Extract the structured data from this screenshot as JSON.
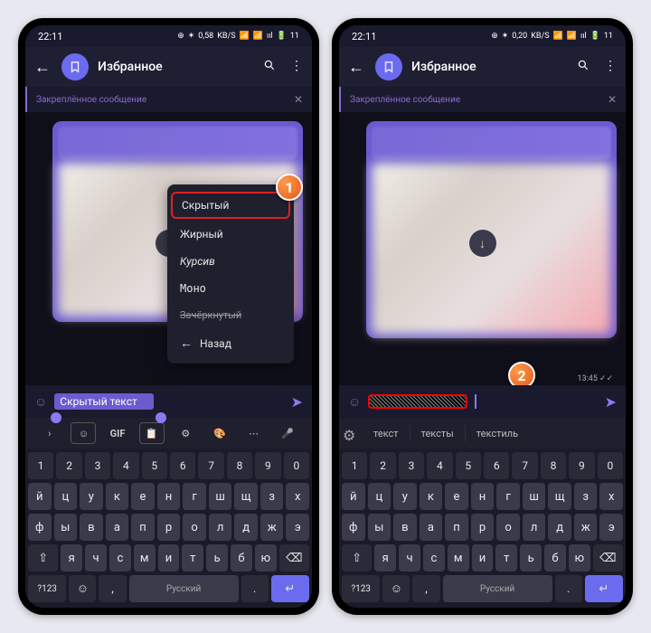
{
  "status": {
    "time": "22:11",
    "net1": "0,58",
    "net2": "0,20",
    "unit": "KB/S",
    "battery": "11"
  },
  "header": {
    "title": "Избранное"
  },
  "pinned": {
    "label": "Закреплённое сообщение"
  },
  "context_menu": {
    "items": [
      "Скрытый",
      "Жирный",
      "Курсив",
      "Моно"
    ],
    "strike": "Зачёркнутый",
    "back": "Назад"
  },
  "callouts": {
    "one": "1",
    "two": "2"
  },
  "input": {
    "left_text": "Скрытый текст"
  },
  "chat": {
    "time": "13:45"
  },
  "kb_tools": {
    "gif": "GIF"
  },
  "suggestions": [
    "текст",
    "тексты",
    "текстиль"
  ],
  "kb": {
    "row_num": [
      "1",
      "2",
      "3",
      "4",
      "5",
      "6",
      "7",
      "8",
      "9",
      "0"
    ],
    "row1": [
      "й",
      "ц",
      "у",
      "к",
      "е",
      "н",
      "г",
      "ш",
      "щ",
      "з",
      "х"
    ],
    "row2": [
      "ф",
      "ы",
      "в",
      "а",
      "п",
      "р",
      "о",
      "л",
      "д",
      "ж",
      "э"
    ],
    "row3": [
      "я",
      "ч",
      "с",
      "м",
      "и",
      "т",
      "ь",
      "б",
      "ю"
    ],
    "sym": "?123",
    "lang": "Русский"
  }
}
